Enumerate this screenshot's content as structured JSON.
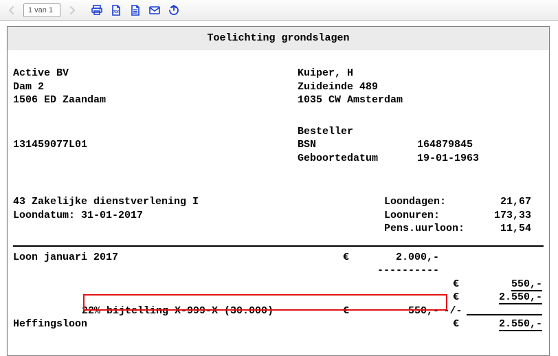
{
  "toolbar": {
    "page_indicator": "1 van 1"
  },
  "title": "Toelichting grondslagen",
  "company": {
    "name": "Active BV",
    "street": "Dam 2",
    "city": "1506 ED Zaandam",
    "code": "131459077L01"
  },
  "person": {
    "name": "Kuiper, H",
    "street": "Zuideinde 489",
    "city": "1035 CW Amsterdam",
    "role": "Besteller",
    "bsn_label": "BSN",
    "bsn": "164879845",
    "dob_label": "Geboortedatum",
    "dob": "19-01-1963"
  },
  "sector": {
    "line": "43 Zakelijke dienstverlening I",
    "loondatum_label": "Loondatum:",
    "loondatum": "31-01-2017"
  },
  "stats": {
    "loondagen_label": "Loondagen:",
    "loondagen": "21,67",
    "loonuren_label": "Loonuren:",
    "loonuren": "173,33",
    "pens_label": "Pens.uurloon:",
    "pens": "11,54"
  },
  "lines": {
    "loon_label": "Loon januari 2017",
    "loon_cur": "€",
    "loon_val": "2.000,-",
    "r1_cur": "€",
    "r1_val": "550,-",
    "r2_cur": "€",
    "r2_val": "2.550,-",
    "bijt_label": "22% bijtelling X-999-X (30.000)",
    "bijt_cur": "€",
    "bijt_val": "550,-",
    "bijt_sep": "-/-",
    "heff_label": "Heffingsloon",
    "heff_cur": "€",
    "heff_val": "2.550,-"
  }
}
